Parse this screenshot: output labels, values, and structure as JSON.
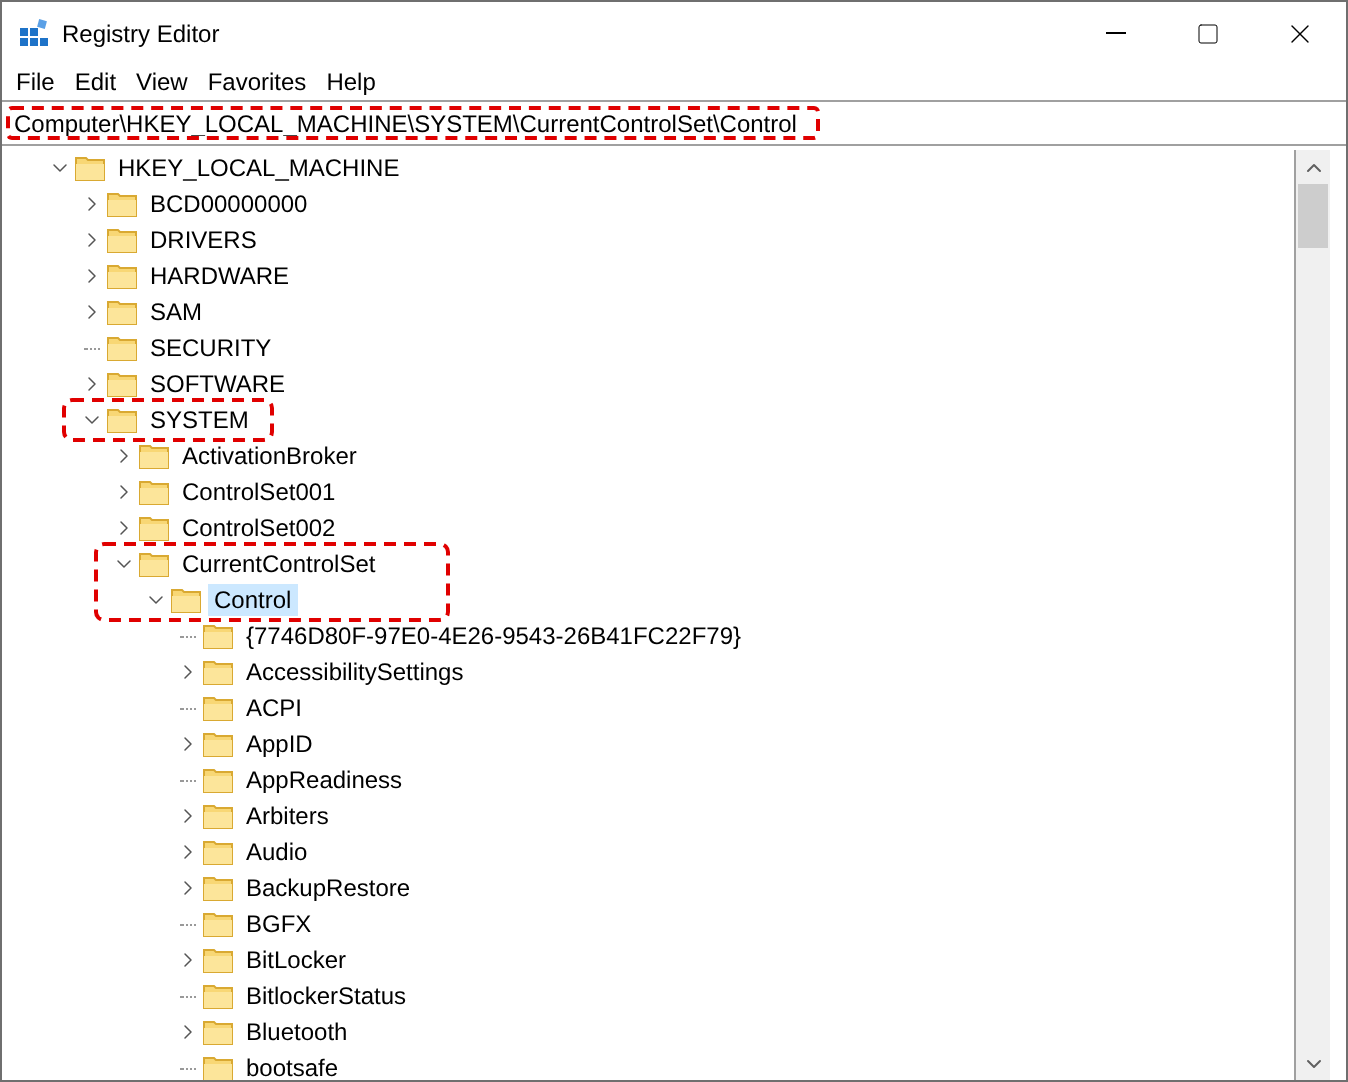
{
  "window": {
    "title": "Registry Editor"
  },
  "menu": [
    "File",
    "Edit",
    "View",
    "Favorites",
    "Help"
  ],
  "address_bar": {
    "value": "Computer\\HKEY_LOCAL_MACHINE\\SYSTEM\\CurrentControlSet\\Control",
    "highlighted": true
  },
  "tree": [
    {
      "label": "HKEY_LOCAL_MACHINE",
      "kind": "folder",
      "expanded": true,
      "selected": false,
      "highlighted": false,
      "children": [
        {
          "label": "BCD00000000",
          "kind": "folder",
          "expanded": false,
          "selected": false,
          "highlighted": false
        },
        {
          "label": "DRIVERS",
          "kind": "folder",
          "expanded": false,
          "selected": false,
          "highlighted": false
        },
        {
          "label": "HARDWARE",
          "kind": "folder",
          "expanded": false,
          "selected": false,
          "highlighted": false
        },
        {
          "label": "SAM",
          "kind": "folder",
          "expanded": false,
          "selected": false,
          "highlighted": false
        },
        {
          "label": "SECURITY",
          "kind": "leaf",
          "selected": false,
          "highlighted": false
        },
        {
          "label": "SOFTWARE",
          "kind": "folder",
          "expanded": false,
          "selected": false,
          "highlighted": false
        },
        {
          "label": "SYSTEM",
          "kind": "folder",
          "expanded": true,
          "selected": false,
          "highlighted": true,
          "children": [
            {
              "label": "ActivationBroker",
              "kind": "folder",
              "expanded": false,
              "selected": false,
              "highlighted": false
            },
            {
              "label": "ControlSet001",
              "kind": "folder",
              "expanded": false,
              "selected": false,
              "highlighted": false
            },
            {
              "label": "ControlSet002",
              "kind": "folder",
              "expanded": false,
              "selected": false,
              "highlighted": false
            },
            {
              "label": "CurrentControlSet",
              "kind": "folder",
              "expanded": true,
              "selected": false,
              "highlighted": true,
              "children": [
                {
                  "label": "Control",
                  "kind": "folder",
                  "expanded": true,
                  "selected": true,
                  "highlighted": true,
                  "children": [
                    {
                      "label": "{7746D80F-97E0-4E26-9543-26B41FC22F79}",
                      "kind": "leaf",
                      "selected": false,
                      "highlighted": false
                    },
                    {
                      "label": "AccessibilitySettings",
                      "kind": "folder",
                      "expanded": false,
                      "selected": false,
                      "highlighted": false
                    },
                    {
                      "label": "ACPI",
                      "kind": "leaf",
                      "selected": false,
                      "highlighted": false
                    },
                    {
                      "label": "AppID",
                      "kind": "folder",
                      "expanded": false,
                      "selected": false,
                      "highlighted": false
                    },
                    {
                      "label": "AppReadiness",
                      "kind": "leaf",
                      "selected": false,
                      "highlighted": false
                    },
                    {
                      "label": "Arbiters",
                      "kind": "folder",
                      "expanded": false,
                      "selected": false,
                      "highlighted": false
                    },
                    {
                      "label": "Audio",
                      "kind": "folder",
                      "expanded": false,
                      "selected": false,
                      "highlighted": false
                    },
                    {
                      "label": "BackupRestore",
                      "kind": "folder",
                      "expanded": false,
                      "selected": false,
                      "highlighted": false
                    },
                    {
                      "label": "BGFX",
                      "kind": "leaf",
                      "selected": false,
                      "highlighted": false
                    },
                    {
                      "label": "BitLocker",
                      "kind": "folder",
                      "expanded": false,
                      "selected": false,
                      "highlighted": false
                    },
                    {
                      "label": "BitlockerStatus",
                      "kind": "leaf",
                      "selected": false,
                      "highlighted": false
                    },
                    {
                      "label": "Bluetooth",
                      "kind": "folder",
                      "expanded": false,
                      "selected": false,
                      "highlighted": false
                    },
                    {
                      "label": "bootsafe",
                      "kind": "leaf",
                      "selected": false,
                      "highlighted": false
                    }
                  ]
                }
              ]
            }
          ]
        }
      ]
    }
  ]
}
